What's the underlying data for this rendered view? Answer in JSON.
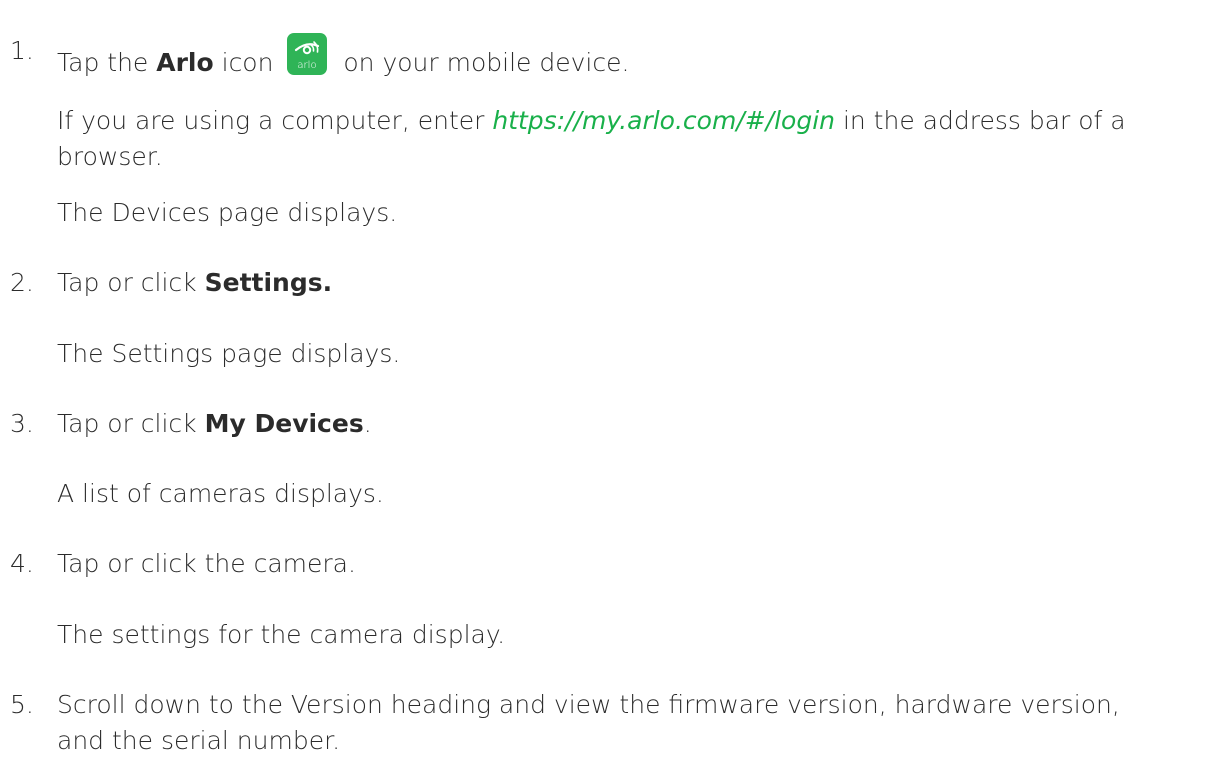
{
  "steps": [
    {
      "num": "1.",
      "pre": "Tap the ",
      "bold": "Arlo",
      "mid": " icon ",
      "icon_text": "arlo",
      "post": " on your mobile device.",
      "note_pre": "If you are using a computer, enter ",
      "note_link": "https://my.arlo.com/#/login",
      "note_post": " in the address bar of a browser.",
      "result": "The Devices page displays."
    },
    {
      "num": "2.",
      "pre": "Tap or click ",
      "bold": "Settings.",
      "result": "The Settings page displays."
    },
    {
      "num": "3.",
      "pre": "Tap or click ",
      "bold": "My Devices",
      "post": ".",
      "result": "A list of cameras displays."
    },
    {
      "num": "4.",
      "text": "Tap or click the camera.",
      "result": "The settings for the camera display."
    },
    {
      "num": "5.",
      "text": "Scroll down to the Version heading and view the firmware version, hardware version, and the serial number."
    }
  ],
  "colors": {
    "link": "#19b04a",
    "icon_bg": "#2fb457",
    "text": "#2b2b2b"
  }
}
